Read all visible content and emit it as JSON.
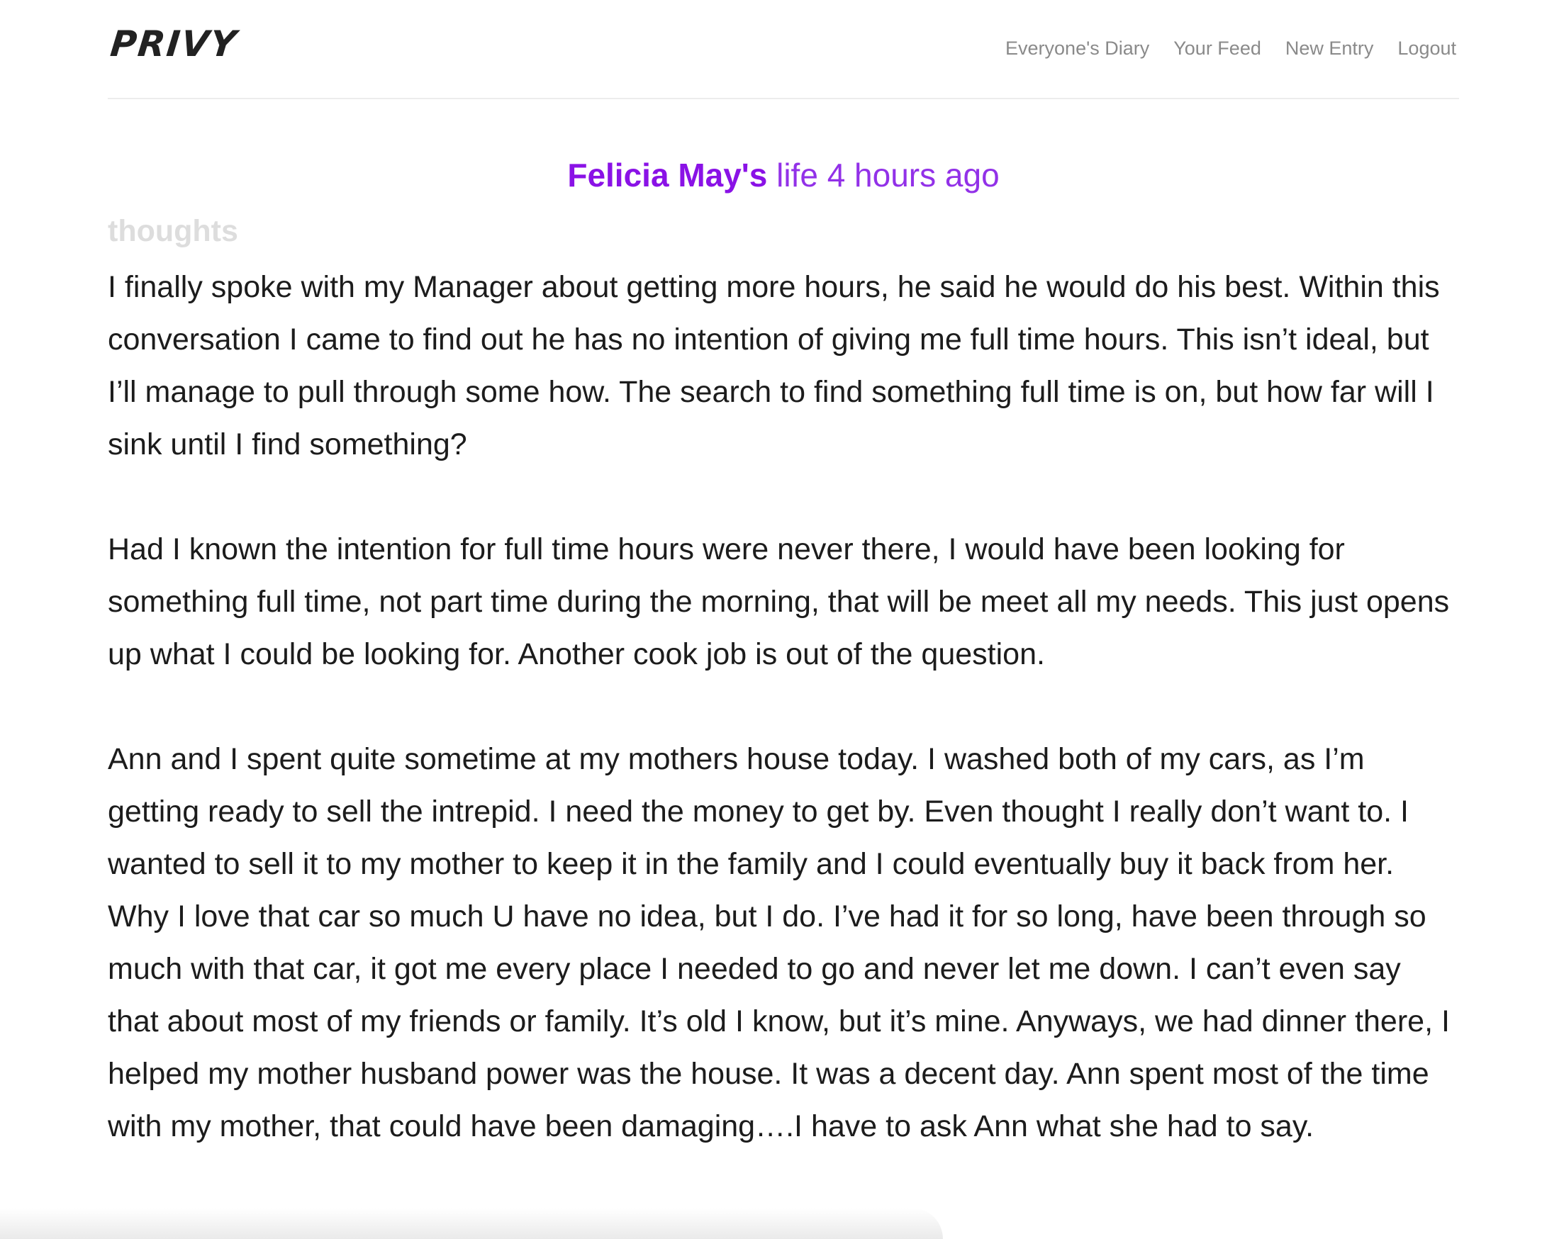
{
  "app": {
    "logo_text": "PRIVY"
  },
  "nav": {
    "items": [
      {
        "label": "Everyone's Diary"
      },
      {
        "label": "Your Feed"
      },
      {
        "label": "New Entry"
      },
      {
        "label": "Logout"
      }
    ]
  },
  "entry": {
    "author": "Felicia May's",
    "meta": "life 4 hours ago",
    "category": "thoughts",
    "paragraphs": [
      "I finally spoke with my Manager about getting more hours, he said he would do his best. Within this conversation I came to find out he has no intention of giving me full time hours. This isn’t ideal, but I’ll manage to pull through some how. The search to find something full time is on, but how far will I sink until I find something?",
      "Had I known the intention for full time hours were never there, I would have been looking for something full time, not part time during the morning, that will be meet all my needs. This just opens up what I could be looking for. Another cook job is out of the question.",
      "Ann and I spent quite sometime at my mothers house today. I washed both of my cars, as I’m getting ready to sell the intrepid. I need the money to get by. Even thought I really don’t want to. I wanted to sell it to my mother to keep it in the family and I could eventually buy it back from her. Why I love that car so much U have no idea, but I do. I’ve had it for so long, have been through so much with that car, it got me every place I needed to go and never let me down. I can’t even say that about most of my friends or family. It’s old I know, but it’s mine. Anyways, we had dinner there, I helped my mother husband power was the house. It was a decent day. Ann spent most of the time with my mother, that could have been damaging….I have to ask Ann what she had to say."
    ]
  },
  "colors": {
    "accent": "#8a12e6",
    "nav_text": "#8a8a8a",
    "category_text": "#dddddd",
    "body_text": "#1c1c1c"
  }
}
